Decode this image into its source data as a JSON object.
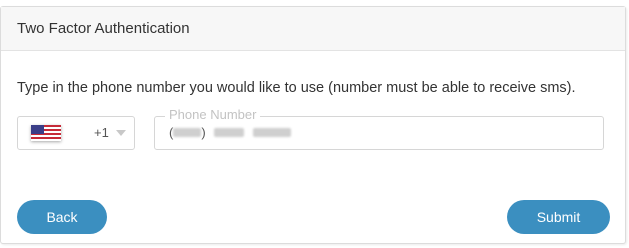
{
  "card": {
    "title": "Two Factor Authentication"
  },
  "instruction": "Type in the phone number you would like to use (number must be able to receive sms).",
  "country_select": {
    "flag_icon": "us-flag-icon",
    "dial_code": "+1"
  },
  "phone_field": {
    "label": "Phone Number",
    "open_paren": "(",
    "close_paren": ")"
  },
  "buttons": {
    "back_label": "Back",
    "submit_label": "Submit"
  },
  "colors": {
    "button_bg": "#3b8fc0",
    "header_bg": "#f7f7f7"
  }
}
